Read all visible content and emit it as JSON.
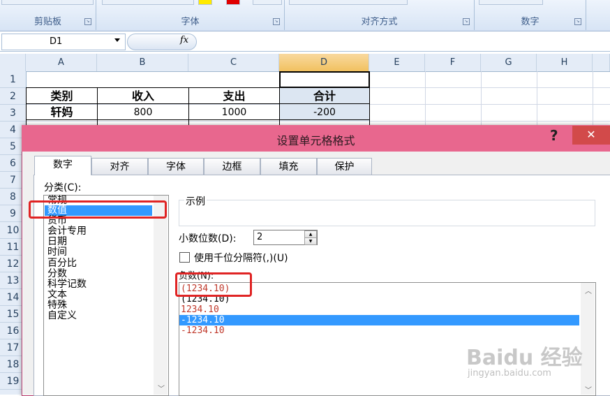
{
  "ribbon": {
    "groups": [
      "剪贴板",
      "字体",
      "对齐方式",
      "数字"
    ]
  },
  "formula_bar": {
    "name_box": "D1",
    "fx": "fx"
  },
  "sheet": {
    "columns": [
      "A",
      "B",
      "C",
      "D",
      "E",
      "F",
      "G",
      "H"
    ],
    "rows": [
      "1",
      "2",
      "3",
      "4",
      "5",
      "6",
      "7",
      "8",
      "9",
      "10",
      "11",
      "12",
      "13",
      "14",
      "15",
      "16",
      "17",
      "18",
      "19"
    ],
    "headers": [
      "类别",
      "收入",
      "支出",
      "合计"
    ],
    "row3": [
      "轩妈",
      "800",
      "1000",
      "-200"
    ]
  },
  "dialog": {
    "title": "设置单元格格式",
    "help": "?",
    "close": "✕",
    "tabs": [
      "数字",
      "对齐",
      "字体",
      "边框",
      "填充",
      "保护"
    ],
    "category_label": "分类(C):",
    "categories": [
      "常规",
      "数值",
      "货币",
      "会计专用",
      "日期",
      "时间",
      "百分比",
      "分数",
      "科学记数",
      "文本",
      "特殊",
      "自定义"
    ],
    "selected_category": "数值",
    "sample_label": "示例",
    "decimal_label": "小数位数(D):",
    "decimal_value": "2",
    "thousands_label": "使用千位分隔符(,)(U)",
    "negative_label": "负数(N):",
    "negative_options": [
      "(1234.10)",
      "(1234.10)",
      "1234.10",
      "-1234.10",
      "-1234.10"
    ],
    "selected_negative": "-1234.10",
    "colors": {
      "title_bar": "#e8678e",
      "selection": "#3399ff",
      "negative_red": "#c0392b",
      "highlight": "#e02424"
    }
  },
  "watermark": {
    "brand": "Baidu 经验",
    "url": "jingyan.baidu.com"
  }
}
